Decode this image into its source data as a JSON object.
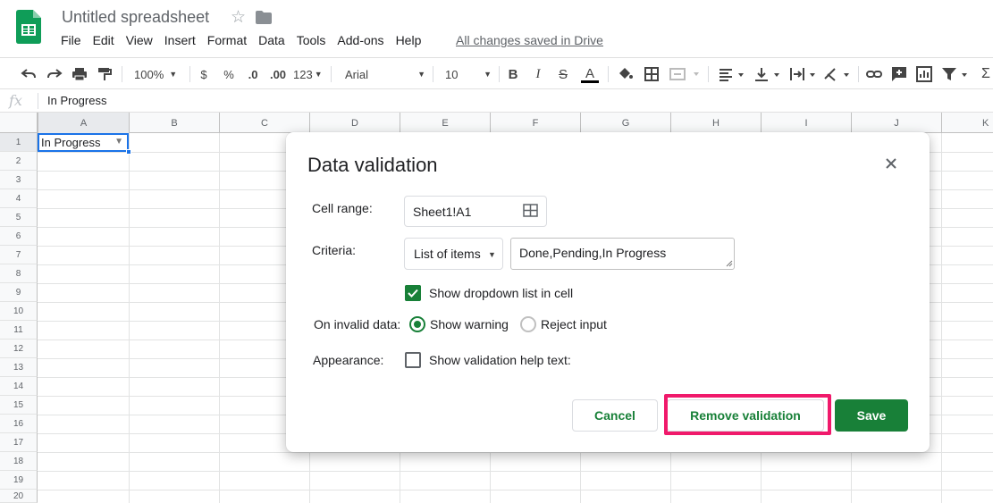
{
  "header": {
    "title": "Untitled spreadsheet",
    "menu": [
      "File",
      "Edit",
      "View",
      "Insert",
      "Format",
      "Data",
      "Tools",
      "Add-ons",
      "Help"
    ],
    "saved_status": "All changes saved in Drive"
  },
  "toolbar": {
    "zoom": "100%",
    "currency": "$",
    "percent": "%",
    "decrease_decimal": ".0",
    "increase_decimal": ".00",
    "more_formats": "123",
    "font": "Arial",
    "font_size": "10",
    "bold": "B",
    "italic": "I",
    "strike": "S",
    "text_color": "A"
  },
  "formula_bar": {
    "fx": "fx",
    "value": "In Progress"
  },
  "grid": {
    "columns": [
      "A",
      "B",
      "C",
      "D",
      "E",
      "F",
      "G",
      "H",
      "I",
      "J",
      "K"
    ],
    "rows": [
      "1",
      "2",
      "3",
      "4",
      "5",
      "6",
      "7",
      "8",
      "9",
      "10",
      "11",
      "12",
      "13",
      "14",
      "15",
      "16",
      "17",
      "18",
      "19",
      "20"
    ],
    "cell_A1": "In Progress"
  },
  "dialog": {
    "title": "Data validation",
    "cell_range_label": "Cell range:",
    "cell_range_value": "Sheet1!A1",
    "criteria_label": "Criteria:",
    "criteria_type": "List of items",
    "criteria_items": "Done,Pending,In Progress",
    "show_dropdown_label": "Show dropdown list in cell",
    "show_dropdown_checked": true,
    "invalid_label": "On invalid data:",
    "show_warning_label": "Show warning",
    "reject_input_label": "Reject input",
    "appearance_label": "Appearance:",
    "help_text_label": "Show validation help text:",
    "cancel": "Cancel",
    "remove_validation": "Remove validation",
    "save": "Save"
  },
  "colors": {
    "accent_green": "#188038",
    "selection_blue": "#1a73e8",
    "highlight_pink": "#f0196b"
  }
}
